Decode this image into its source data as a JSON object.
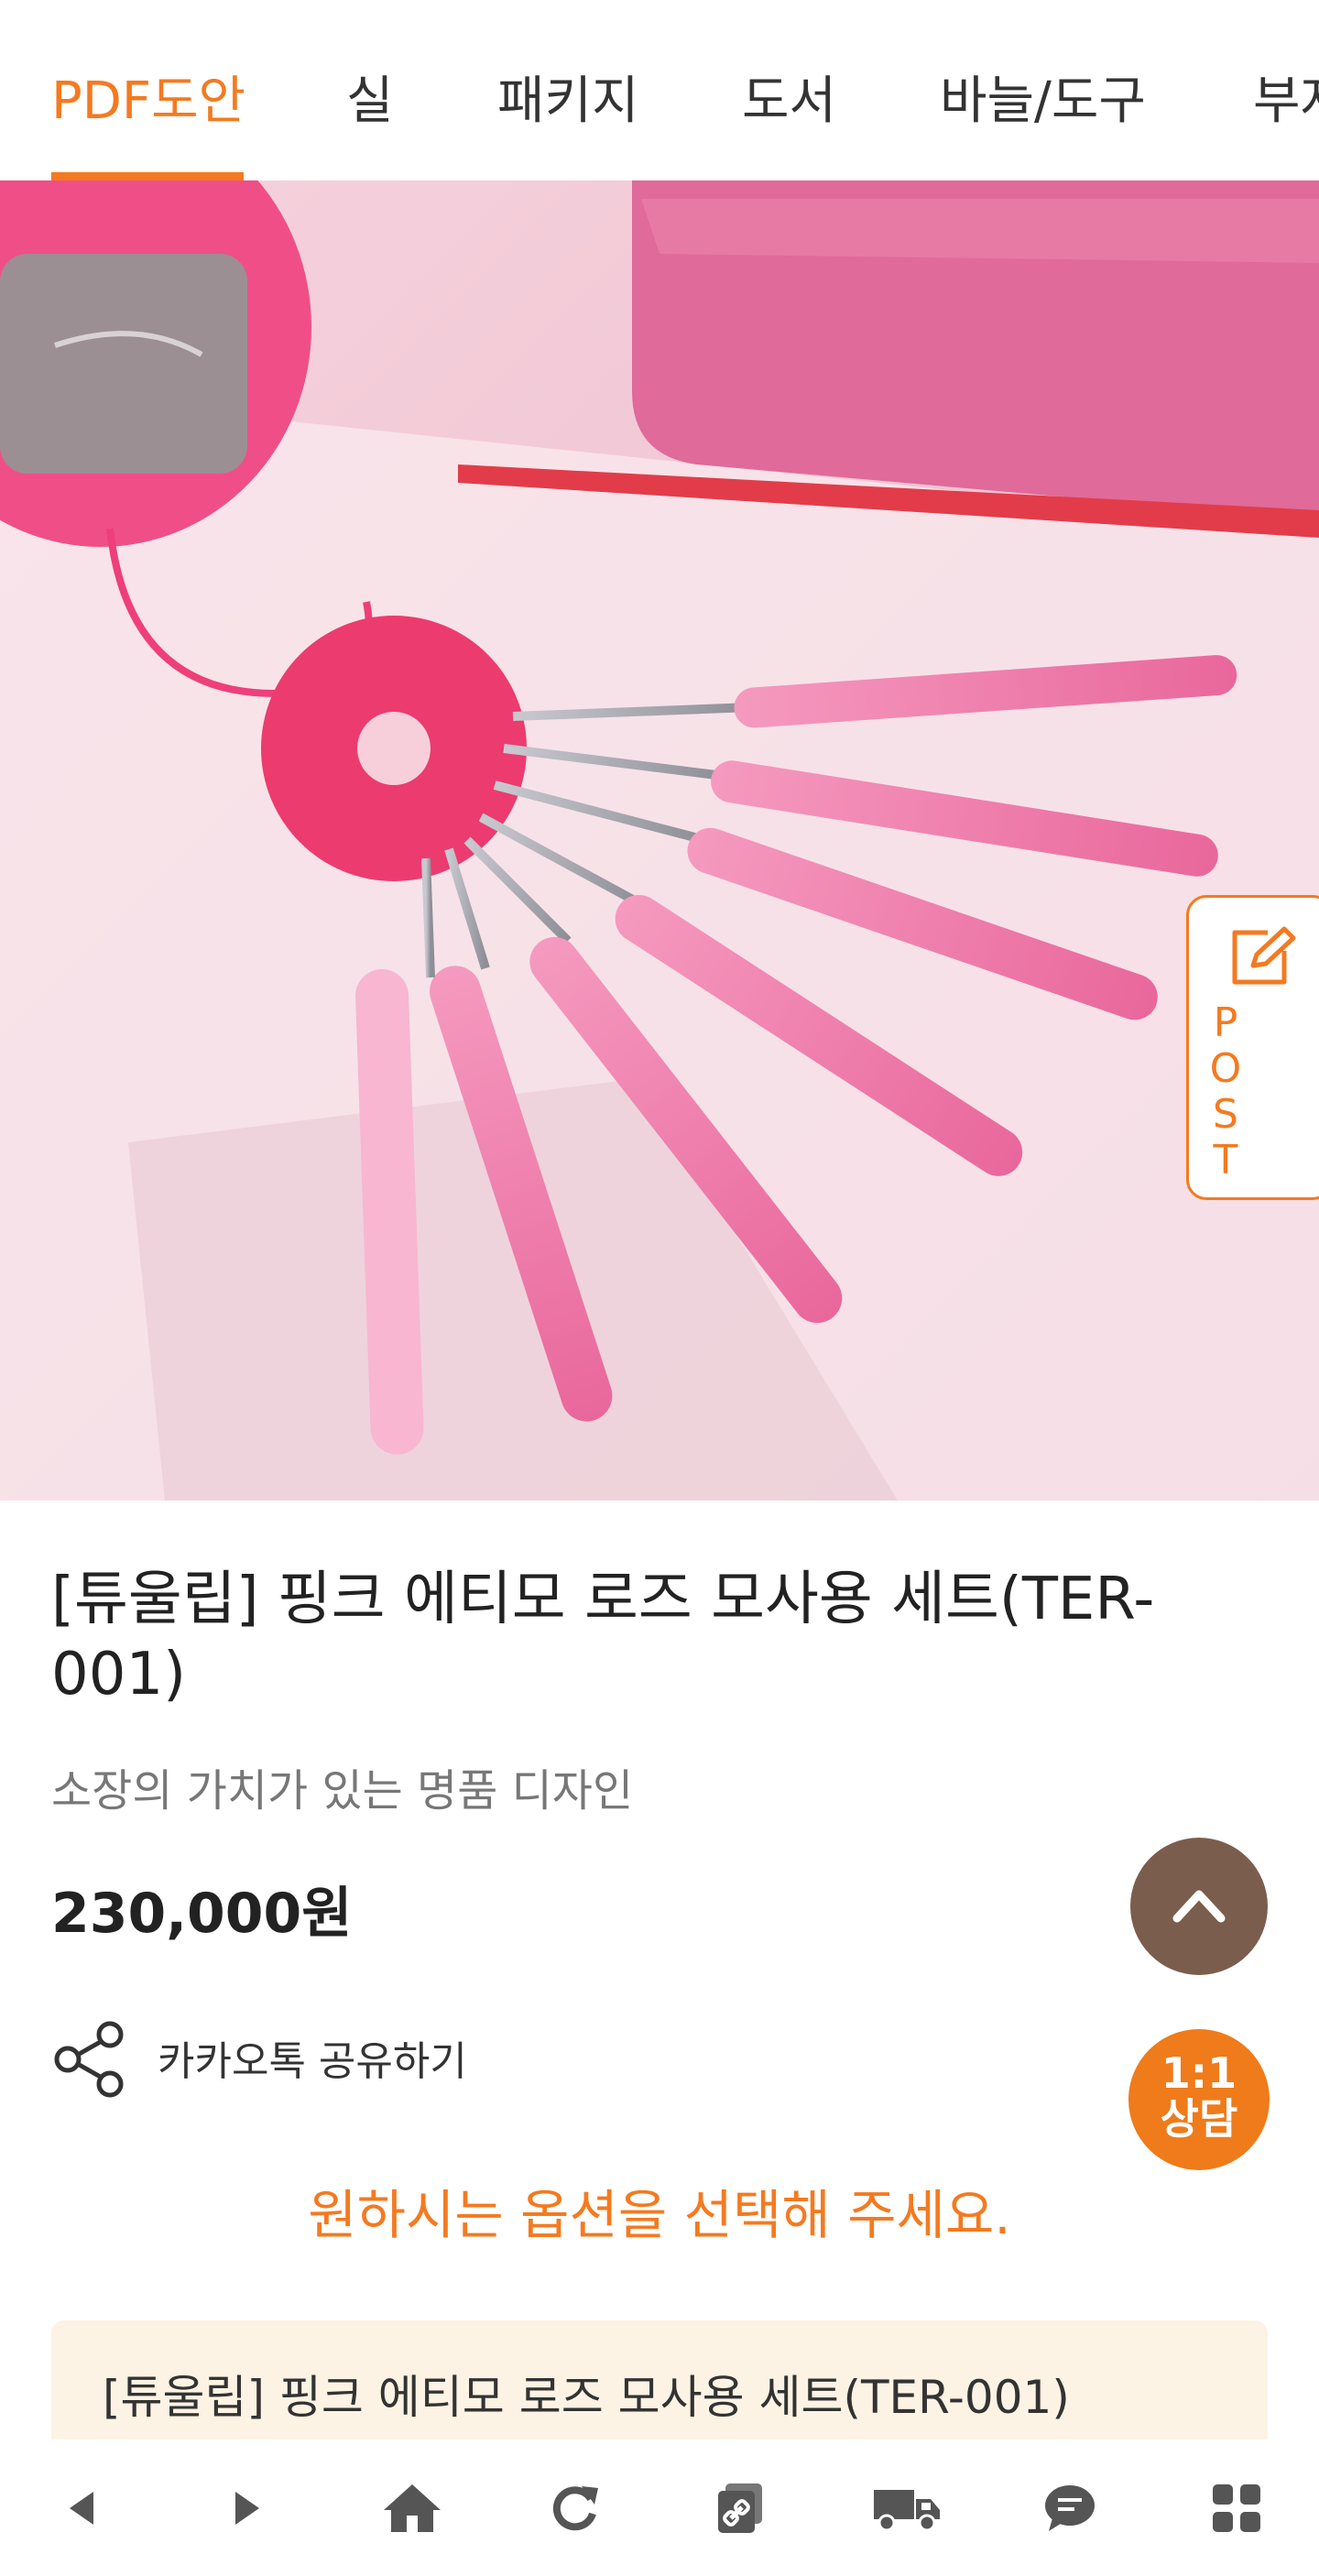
{
  "tabs": [
    {
      "label": "PDF도안",
      "active": true
    },
    {
      "label": "실"
    },
    {
      "label": "패키지"
    },
    {
      "label": "도서"
    },
    {
      "label": "바늘/도구"
    },
    {
      "label": "부자재"
    }
  ],
  "post_tab": {
    "letters": [
      "P",
      "O",
      "S",
      "T"
    ],
    "icon": "pencil-edit-icon"
  },
  "product": {
    "title": "[튜울립] 핑크 에티모 로즈 모사용 세트(TER-001)",
    "subtitle": "소장의 가치가 있는 명품 디자인",
    "price": "230,000원"
  },
  "share": {
    "label": "카카오톡 공유하기",
    "icon": "share-icon"
  },
  "floating": {
    "scroll_top_icon": "chevron-up-icon",
    "consult_line1": "1:1",
    "consult_line2": "상담"
  },
  "options": {
    "prompt": "원하시는 옵션을 선택해 주세요.",
    "selected_name": "[튜울립] 핑크 에티모 로즈 모사용 세트(TER-001)"
  },
  "bottom_bar": [
    {
      "icon": "back-arrow-icon"
    },
    {
      "icon": "forward-arrow-icon"
    },
    {
      "icon": "home-icon"
    },
    {
      "icon": "refresh-icon"
    },
    {
      "icon": "copy-link-icon"
    },
    {
      "icon": "delivery-truck-icon"
    },
    {
      "icon": "chat-icon"
    },
    {
      "icon": "menu-grid-icon"
    }
  ],
  "colors": {
    "accent": "#f47a20",
    "scroll_top_bg": "#7b5d4e",
    "consult_bg": "#ef7b1a",
    "option_box_bg": "#fdf3e4",
    "bottom_icons": "#555555"
  }
}
